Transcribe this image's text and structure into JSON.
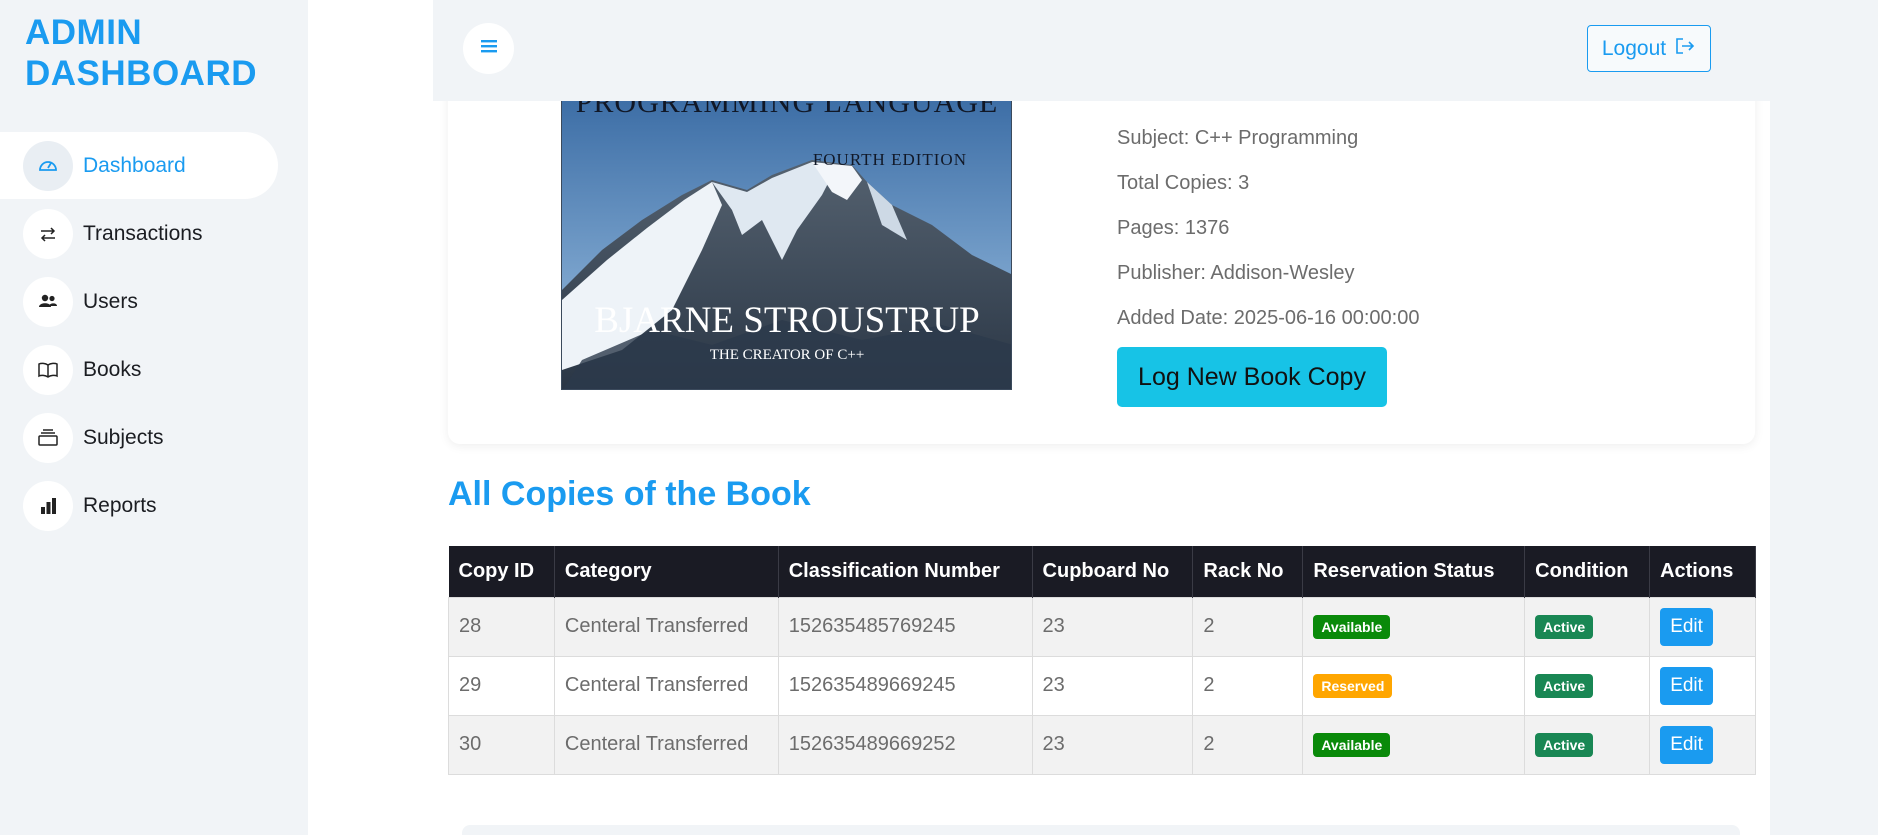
{
  "brand": {
    "line1": "ADMIN",
    "line2": "DASHBOARD"
  },
  "sidebar": {
    "items": [
      {
        "label": "Dashboard",
        "icon": "gauge-icon",
        "active": true
      },
      {
        "label": "Transactions",
        "icon": "arrows-exchange-icon"
      },
      {
        "label": "Users",
        "icon": "users-icon"
      },
      {
        "label": "Books",
        "icon": "book-open-icon"
      },
      {
        "label": "Subjects",
        "icon": "stack-icon"
      },
      {
        "label": "Reports",
        "icon": "bar-chart-icon"
      }
    ]
  },
  "topbar": {
    "menu_icon": "hamburger-icon",
    "logout_label": "Logout",
    "logout_icon": "logout-icon"
  },
  "book": {
    "cover": {
      "title_partial": "PROGRAMMING LANGUAGE",
      "edition": "FOURTH EDITION",
      "author": "BJARNE STROUSTRUP",
      "tagline": "THE CREATOR OF C++"
    },
    "subject": "Subject: C++ Programming",
    "total_copies": "Total Copies: 3",
    "pages": "Pages: 1376",
    "publisher": "Publisher: Addison-Wesley",
    "added_date": "Added Date: 2025-06-16 00:00:00",
    "log_button": "Log New Book Copy"
  },
  "copies": {
    "title": "All Copies of the Book",
    "headers": [
      "Copy ID",
      "Category",
      "Classification Number",
      "Cupboard No",
      "Rack No",
      "Reservation Status",
      "Condition",
      "Actions"
    ],
    "rows": [
      {
        "id": "28",
        "category": "Centeral Transferred",
        "classification": "152635485769245",
        "cupboard": "23",
        "rack": "2",
        "reservation": "Available",
        "condition": "Active",
        "action": "Edit"
      },
      {
        "id": "29",
        "category": "Centeral Transferred",
        "classification": "152635489669245",
        "cupboard": "23",
        "rack": "2",
        "reservation": "Reserved",
        "condition": "Active",
        "action": "Edit"
      },
      {
        "id": "30",
        "category": "Centeral Transferred",
        "classification": "152635489669252",
        "cupboard": "23",
        "rack": "2",
        "reservation": "Available",
        "condition": "Active",
        "action": "Edit"
      }
    ]
  },
  "colors": {
    "accent": "#1a9bf0",
    "table_header": "#1a1b24",
    "available": "#0a8a0a",
    "reserved": "#ffa600",
    "active": "#198754",
    "log_button": "#17c3e6"
  }
}
